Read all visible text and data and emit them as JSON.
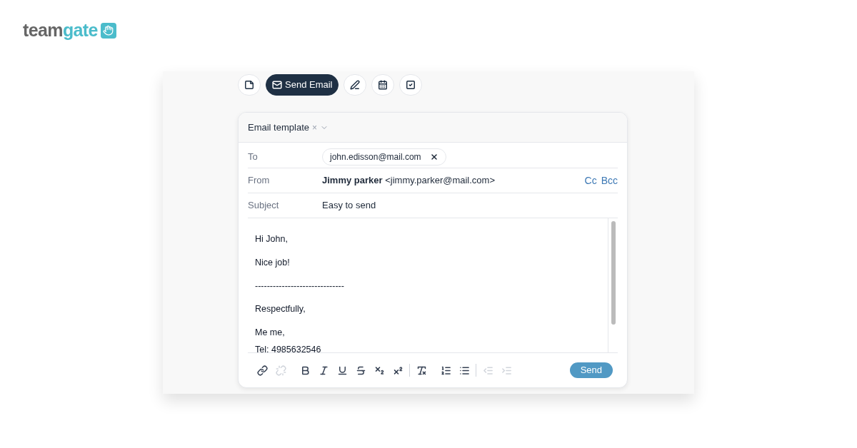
{
  "logo": {
    "text_dark": "team",
    "text_accent": "gate"
  },
  "tabs": [
    {
      "kind": "note",
      "selected": false
    },
    {
      "kind": "email",
      "label": "Send Email",
      "selected": true
    },
    {
      "kind": "call",
      "selected": false
    },
    {
      "kind": "meeting",
      "selected": false
    },
    {
      "kind": "task",
      "selected": false
    }
  ],
  "template": {
    "label": "Email template",
    "clear": "×"
  },
  "fields": [
    {
      "kind": "to",
      "label": "To",
      "chip": "john.edisson@mail.com"
    },
    {
      "kind": "from",
      "label": "From",
      "name": "Jimmy parker",
      "address": "<jimmy.parker@mail.com>",
      "links": [
        "Cc",
        "Bcc"
      ]
    },
    {
      "kind": "subject",
      "label": "Subject",
      "value": "Easy to send"
    }
  ],
  "body": [
    [
      "Hi John,"
    ],
    [
      "Nice job!"
    ],
    [
      "------------------------------"
    ],
    [
      "Respectfully,"
    ],
    [
      "Me me,",
      "Tel: 4985632546"
    ]
  ],
  "toolbar": [
    {
      "kind": "link",
      "disabled": false
    },
    {
      "kind": "unlink",
      "disabled": true
    },
    {
      "kind": "sep"
    },
    {
      "kind": "bold",
      "disabled": false
    },
    {
      "kind": "italic",
      "disabled": false
    },
    {
      "kind": "underline",
      "disabled": false
    },
    {
      "kind": "strike",
      "disabled": false
    },
    {
      "kind": "subscript",
      "disabled": false
    },
    {
      "kind": "superscript",
      "disabled": false
    },
    {
      "kind": "divider"
    },
    {
      "kind": "clear",
      "disabled": false
    },
    {
      "kind": "sep"
    },
    {
      "kind": "ordered",
      "disabled": false
    },
    {
      "kind": "bullets",
      "disabled": false
    },
    {
      "kind": "divider"
    },
    {
      "kind": "outdent",
      "disabled": true
    },
    {
      "kind": "indent",
      "disabled": true
    }
  ],
  "send": "Send"
}
